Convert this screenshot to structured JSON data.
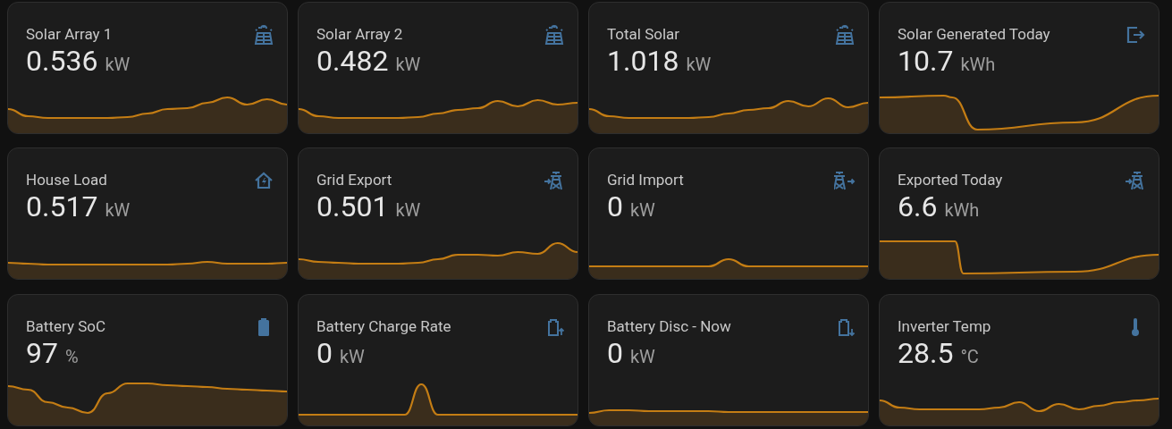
{
  "cards": [
    {
      "title": "Solar Array 1",
      "value": "0.536",
      "unit": "kW"
    },
    {
      "title": "Solar Array 2",
      "value": "0.482",
      "unit": "kW"
    },
    {
      "title": "Total Solar",
      "value": "1.018",
      "unit": "kW"
    },
    {
      "title": "Solar Generated Today",
      "value": "10.7",
      "unit": "kWh"
    },
    {
      "title": "House Load",
      "value": "0.517",
      "unit": "kW"
    },
    {
      "title": "Grid Export",
      "value": "0.501",
      "unit": "kW"
    },
    {
      "title": "Grid Import",
      "value": "0",
      "unit": "kW"
    },
    {
      "title": "Exported Today",
      "value": "6.6",
      "unit": "kWh"
    },
    {
      "title": "Battery SoC",
      "value": "97",
      "unit": "%"
    },
    {
      "title": "Battery Charge Rate",
      "value": "0",
      "unit": "kW"
    },
    {
      "title": "Battery Disc - Now",
      "value": "0",
      "unit": "kW"
    },
    {
      "title": "Inverter Temp",
      "value": "28.5",
      "unit": "°C"
    }
  ]
}
